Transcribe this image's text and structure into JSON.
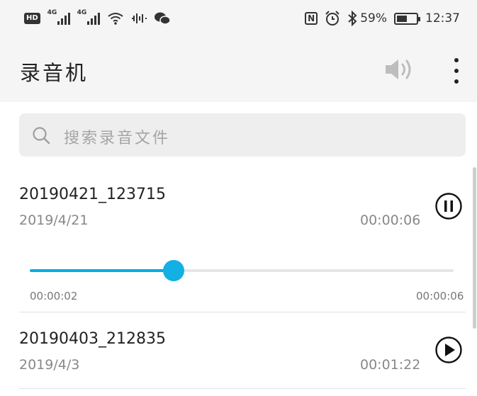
{
  "status_bar": {
    "hd": "HD",
    "network_1": "4G",
    "network_2": "4G",
    "battery_percent_label": "59%",
    "battery_level": 0.59,
    "time": "12:37",
    "nfc": "N",
    "icons": [
      "signal-icon",
      "wifi-icon",
      "voice-activity-icon",
      "wechat-icon",
      "nfc-icon",
      "alarm-icon",
      "bluetooth-icon",
      "battery-icon"
    ]
  },
  "app_bar": {
    "title": "录音机",
    "icons": [
      "speaker-icon",
      "more-vertical-icon"
    ]
  },
  "search": {
    "placeholder": "搜索录音文件",
    "icon": "search-icon"
  },
  "recordings": [
    {
      "name": "20190421_123715",
      "date": "2019/4/21",
      "duration": "00:00:06",
      "state": "playing",
      "icon": "pause-icon",
      "progress": {
        "elapsed": "00:00:02",
        "total": "00:00:06",
        "fraction": 0.34
      }
    },
    {
      "name": "20190403_212835",
      "date": "2019/4/3",
      "duration": "00:01:22",
      "state": "stopped",
      "icon": "play-icon"
    }
  ],
  "colors": {
    "accent": "#00aee6",
    "background": "#f5f5f5",
    "search_bg": "#eeeeee"
  }
}
